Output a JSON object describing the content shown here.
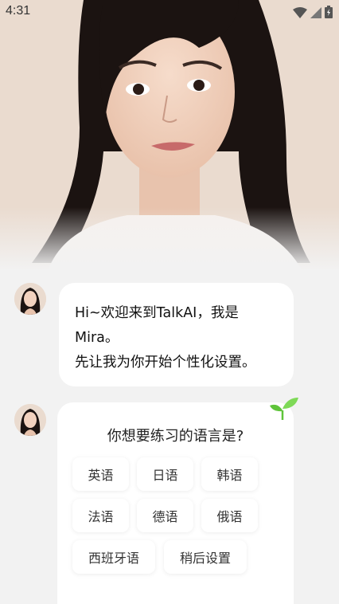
{
  "status_bar": {
    "time": "4:31",
    "icons": [
      "wifi-icon",
      "signal-icon",
      "battery-icon"
    ]
  },
  "hero": {
    "image": "portrait of a woman with long black hair"
  },
  "chat": {
    "message1": {
      "lines": [
        "Hi~欢迎来到TalkAI，我是",
        "Mira。",
        "先让我为你开始个性化设置。"
      ]
    },
    "message2": {
      "question": "你想要练习的语言是?",
      "options": [
        "英语",
        "日语",
        "韩语",
        "法语",
        "德语",
        "俄语",
        "西班牙语",
        "稍后设置"
      ]
    }
  },
  "colors": {
    "background": "#f2f2f2",
    "bubble": "#ffffff",
    "sprout": "#5fc43a"
  }
}
